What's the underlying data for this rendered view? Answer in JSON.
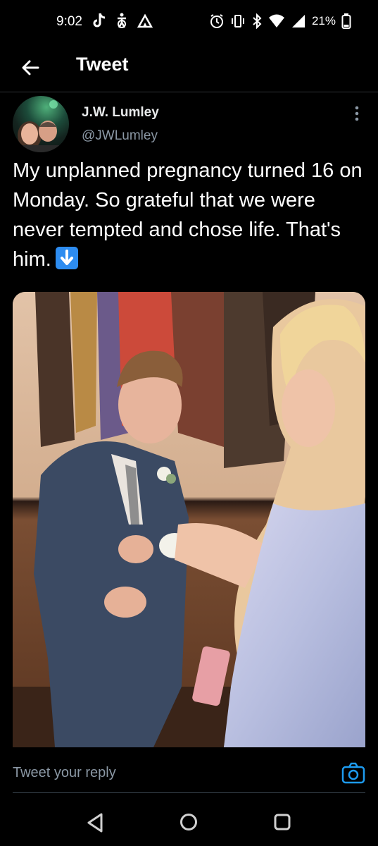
{
  "status_bar": {
    "time": "9:02",
    "battery_percent": "21%",
    "left_icons": [
      "tiktok-icon",
      "accessibility-icon",
      "camping-icon"
    ],
    "right_icons": [
      "alarm-icon",
      "vibrate-icon",
      "bluetooth-icon",
      "wifi-icon",
      "cell-signal-icon",
      "battery-icon"
    ]
  },
  "header": {
    "title": "Tweet"
  },
  "tweet": {
    "author_name": "J.W. Lumley",
    "author_handle": "@JWLumley",
    "text": "My unplanned pregnancy turned 16 on Monday. So grateful that we were never tempted and chose life. That's him.",
    "emoji": "down-arrow-emoji",
    "media": "photo"
  },
  "reply": {
    "placeholder": "Tweet your reply"
  },
  "nav": {
    "icons": [
      "back-icon",
      "home-icon",
      "recents-icon"
    ]
  },
  "colors": {
    "background": "#000000",
    "text_primary": "#e7e9ea",
    "text_secondary": "#8b98a5",
    "accent": "#1d9bf0"
  }
}
